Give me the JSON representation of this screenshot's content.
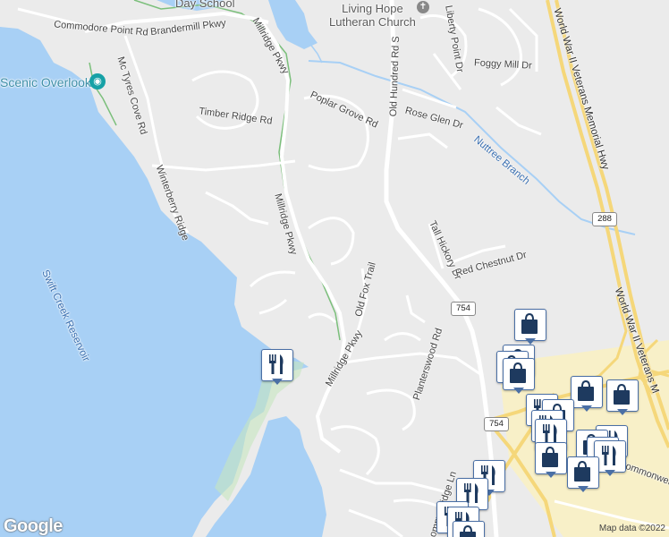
{
  "map": {
    "places": {
      "day_school": "Day School",
      "church": "Living Hope Lutheran Church",
      "church_line1": "Living Hope",
      "church_line2": "Lutheran Church",
      "scenic_overlook": "Scenic Overlook"
    },
    "water": {
      "reservoir": "Swift Creek Reservoir",
      "branch": "Nuttree Branch"
    },
    "roads": {
      "commodore_point": "Commodore Point Rd",
      "brandermill": "Brandermill Pkwy",
      "millridge_top": "Millridge Pkwy",
      "millridge_mid": "Millridge Pkwy",
      "millridge_low": "Millridge Pkwy",
      "mctyres_cove": "Mc Tyres Cove Rd",
      "timber_ridge": "Timber Ridge Rd",
      "poplar_grove": "Poplar Grove Rd",
      "winterberry": "Winterberry Ridge",
      "old_hundred": "Old Hundred Rd S",
      "liberty_point": "Liberty Point Dr",
      "foggy_mill": "Foggy Mill Dr",
      "rose_glen": "Rose Glen Dr",
      "tall_hickory": "Tall Hickory Dr",
      "red_chestnut": "Red Chestnut Dr",
      "old_fox": "Old Fox Trail",
      "planterswood": "Planterswood Rd",
      "commonwealth": "Commonwealth",
      "ommonridge": "ommonridge Ln",
      "wwii_hwy_1": "World War II Veterans Memorial Hwy",
      "wwii_hwy_2": "World War II Veterans M"
    },
    "shields": {
      "r288": "288",
      "r754a": "754",
      "r754b": "754"
    },
    "attribution": {
      "logo": "Google",
      "map_data": "Map data ©2022"
    }
  },
  "colors": {
    "water": "#a8d0f5",
    "land": "#ebebeb",
    "park": "#c6e6c0",
    "commercial": "#f8f0c8",
    "road": "#ffffff",
    "highway": "#f5d77a",
    "pin_border": "#4a6fa5",
    "pin_icon": "#1e3a5f"
  }
}
